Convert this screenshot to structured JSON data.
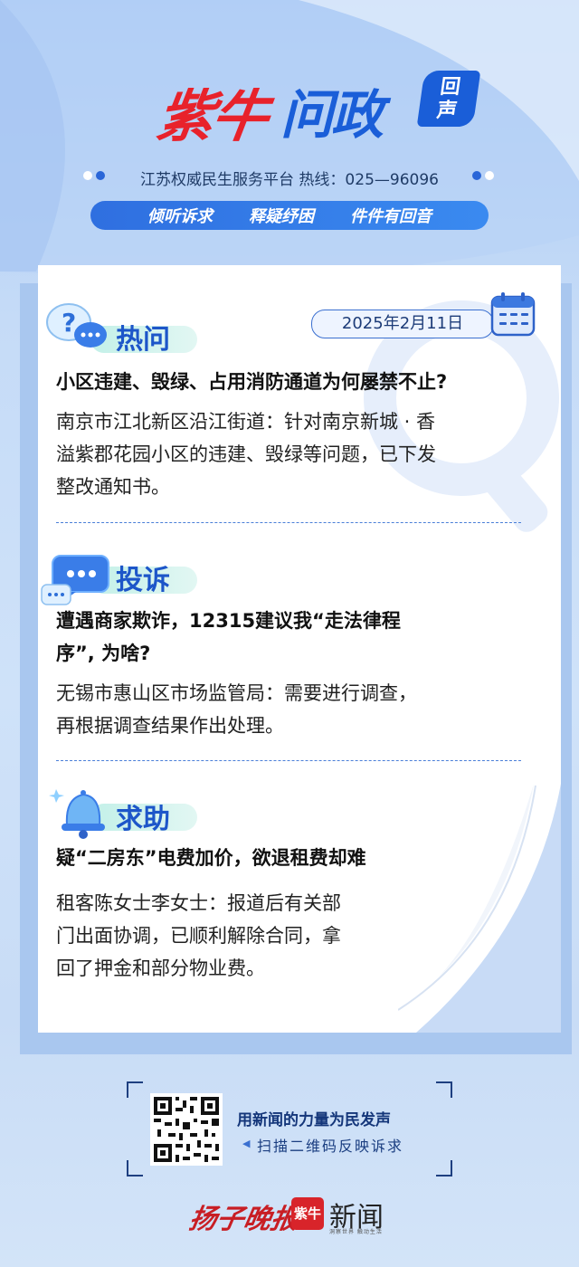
{
  "header": {
    "logo_red": "紫牛",
    "logo_blue": "问政",
    "logo_badge": "回声",
    "tagline": "江苏权威民生服务平台  热线：025—96096",
    "slogans": [
      "倾听诉求",
      "释疑纾困",
      "件件有回音"
    ]
  },
  "date": "2025年2月11日",
  "sections": [
    {
      "title": "热问",
      "question": "小区违建、毁绿、占用消防通道为何屡禁不止?",
      "answer_lines": [
        "南京市江北新区沿江街道：针对南京新城 · 香",
        "溢紫郡花园小区的违建、毁绿等问题，已下发",
        "整改通知书。"
      ]
    },
    {
      "title": "投诉",
      "question_lines": [
        "遭遇商家欺诈，12315建议我“走法律程",
        "序”, 为啥?"
      ],
      "answer_lines": [
        "无锡市惠山区市场监管局：需要进行调查，",
        "再根据调查结果作出处理。"
      ]
    },
    {
      "title": "求助",
      "question": "疑“二房东”电费加价，欲退租费却难",
      "answer_lines": [
        "租客陈女士李女士：报道后有关部",
        "门出面协调，已顺利解除合同，拿",
        "回了押金和部分物业费。"
      ]
    }
  ],
  "footer": {
    "qr_line1": "用新闻的力量为民发声",
    "qr_line2": "扫描二维码反映诉求",
    "brand_paper": "扬子晚报",
    "brand_badge": "紫牛",
    "brand_news": "新闻",
    "brand_small": "洞察世界 触动生活"
  },
  "colors": {
    "accent_blue": "#1d56c9",
    "brand_red": "#e8222b",
    "card_bg": "#ffffff"
  }
}
